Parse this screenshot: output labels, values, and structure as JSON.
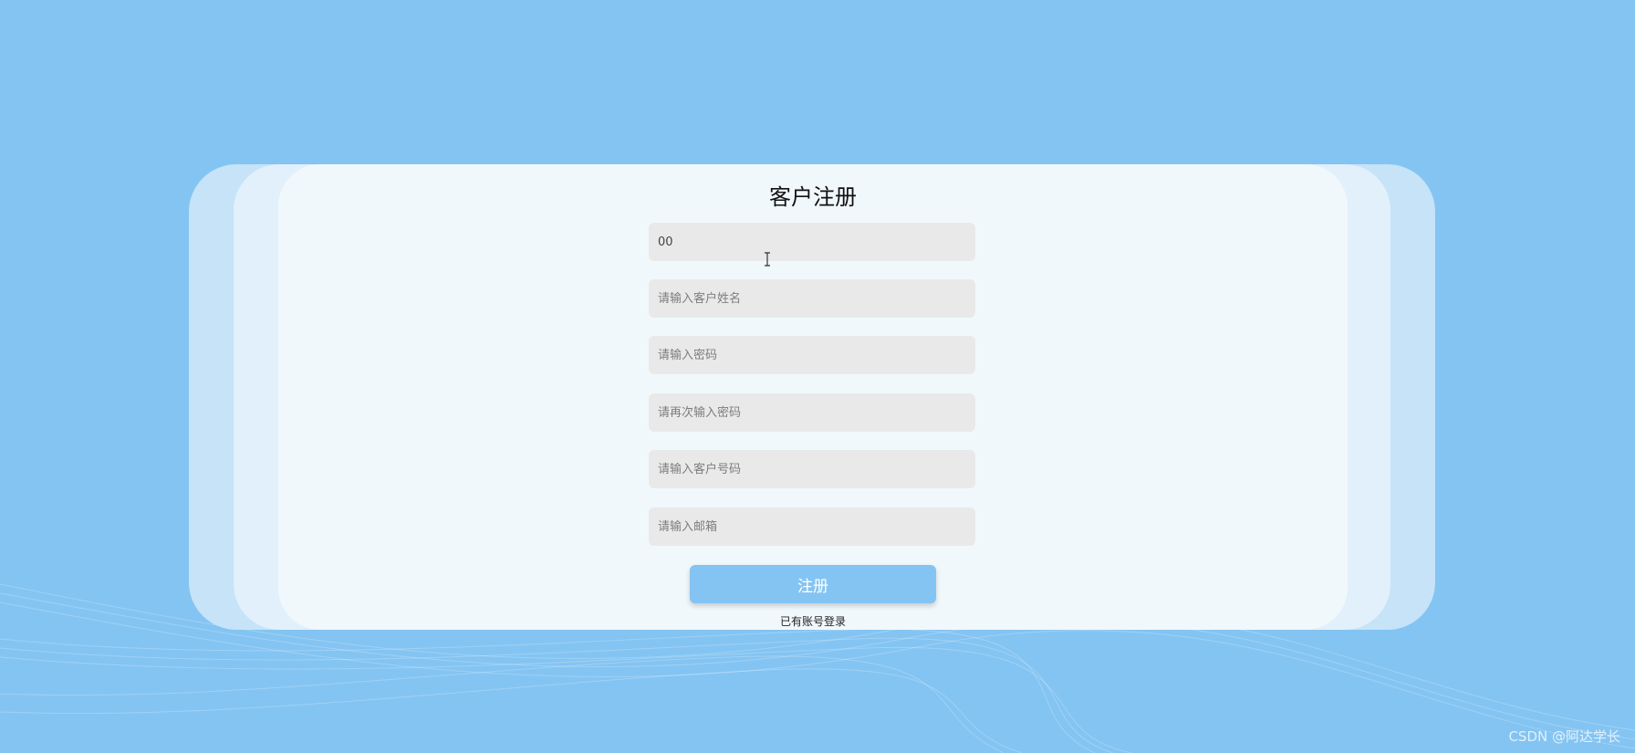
{
  "form": {
    "title": "客户注册",
    "fields": [
      {
        "id": "customer-id",
        "value": "00",
        "placeholder": ""
      },
      {
        "id": "customer-name",
        "value": "",
        "placeholder": "请输入客户姓名"
      },
      {
        "id": "password",
        "value": "",
        "placeholder": "请输入密码"
      },
      {
        "id": "password-confirm",
        "value": "",
        "placeholder": "请再次输入密码"
      },
      {
        "id": "customer-phone",
        "value": "",
        "placeholder": "请输入客户号码"
      },
      {
        "id": "email",
        "value": "",
        "placeholder": "请输入邮箱"
      }
    ],
    "submit_label": "注册",
    "login_link": "已有账号登录"
  },
  "watermark": "CSDN @阿达学长",
  "colors": {
    "background": "#84c4f2",
    "card": "#f1f8fc",
    "input": "#e9e9e9",
    "button": "#84c4f2"
  },
  "icons": {
    "cursor": "text-cursor-icon"
  }
}
